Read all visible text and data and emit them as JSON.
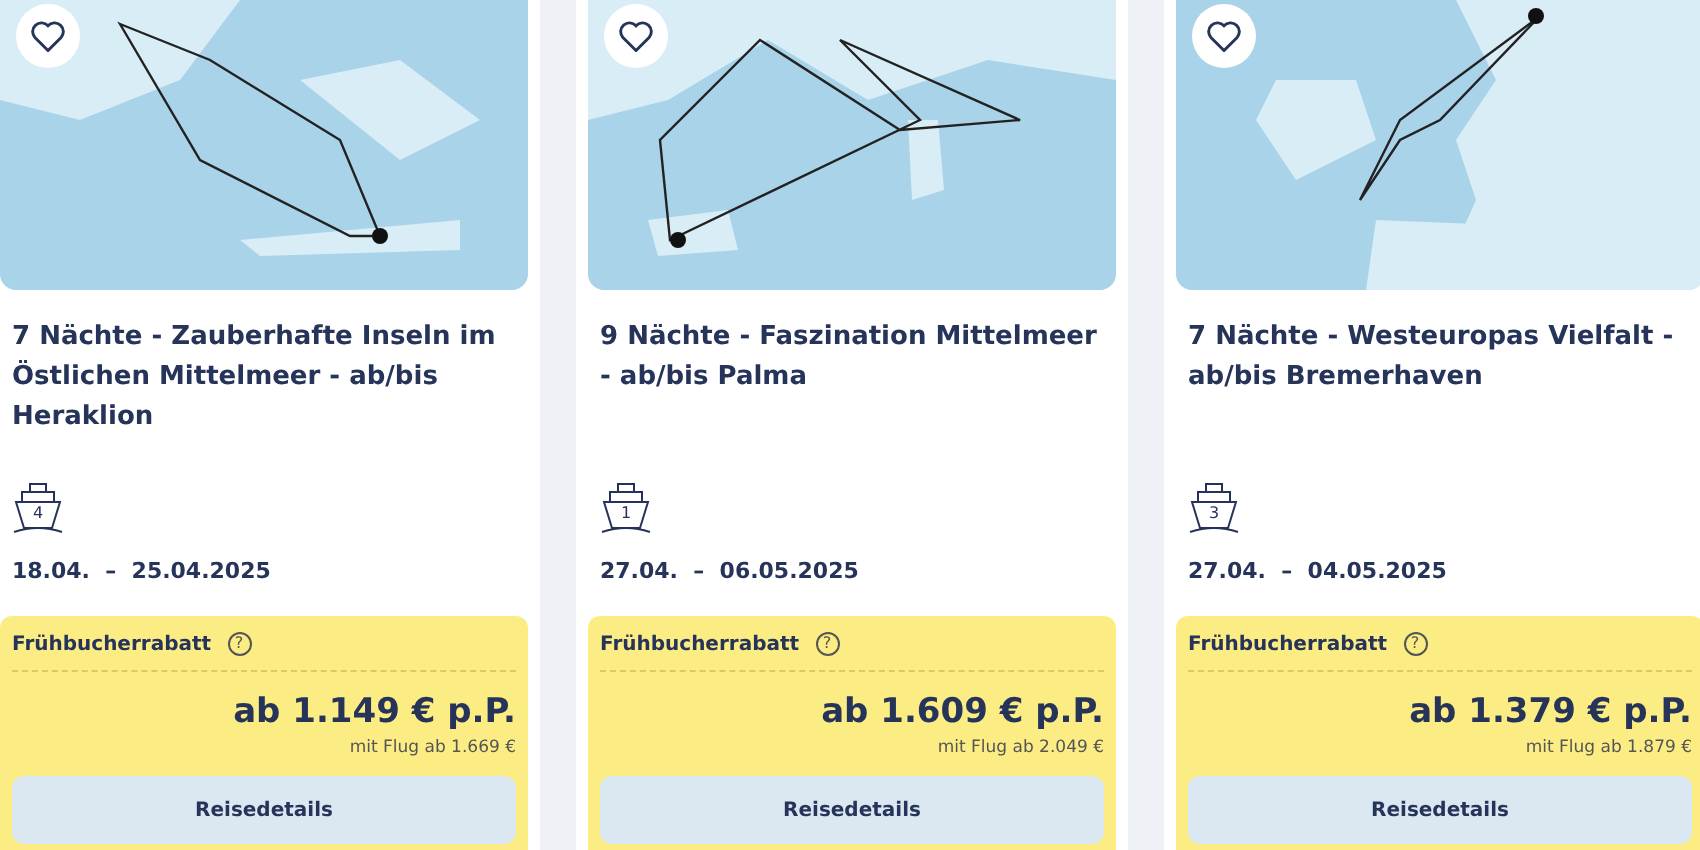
{
  "cards": [
    {
      "favorite": false,
      "title": "7 Nächte - Zauberhafte Inseln im Östlichen Mittelmeer - ab/bis Heraklion",
      "ship_number": "4",
      "dates": "18.04.  –  25.04.2025",
      "discount": "Frühbucherrabatt",
      "help": "?",
      "price": "ab 1.149 € p.P.",
      "flight_price": "mit Flug ab 1.669 €",
      "button": "Reisedetails"
    },
    {
      "favorite": false,
      "title": "9 Nächte - Faszination Mittelmeer - ab/bis Palma",
      "ship_number": "1",
      "dates": "27.04.  –  06.05.2025",
      "discount": "Frühbucherrabatt",
      "help": "?",
      "price": "ab 1.609 € p.P.",
      "flight_price": "mit Flug ab 2.049 €",
      "button": "Reisedetails"
    },
    {
      "favorite": false,
      "title": "7 Nächte - Westeuropas Vielfalt - ab/bis Bremerhaven",
      "ship_number": "3",
      "dates": "27.04.  –  04.05.2025",
      "discount": "Frühbucherrabatt",
      "help": "?",
      "price": "ab 1.379 € p.P.",
      "flight_price": "mit Flug ab 1.879 €",
      "button": "Reisedetails"
    }
  ]
}
